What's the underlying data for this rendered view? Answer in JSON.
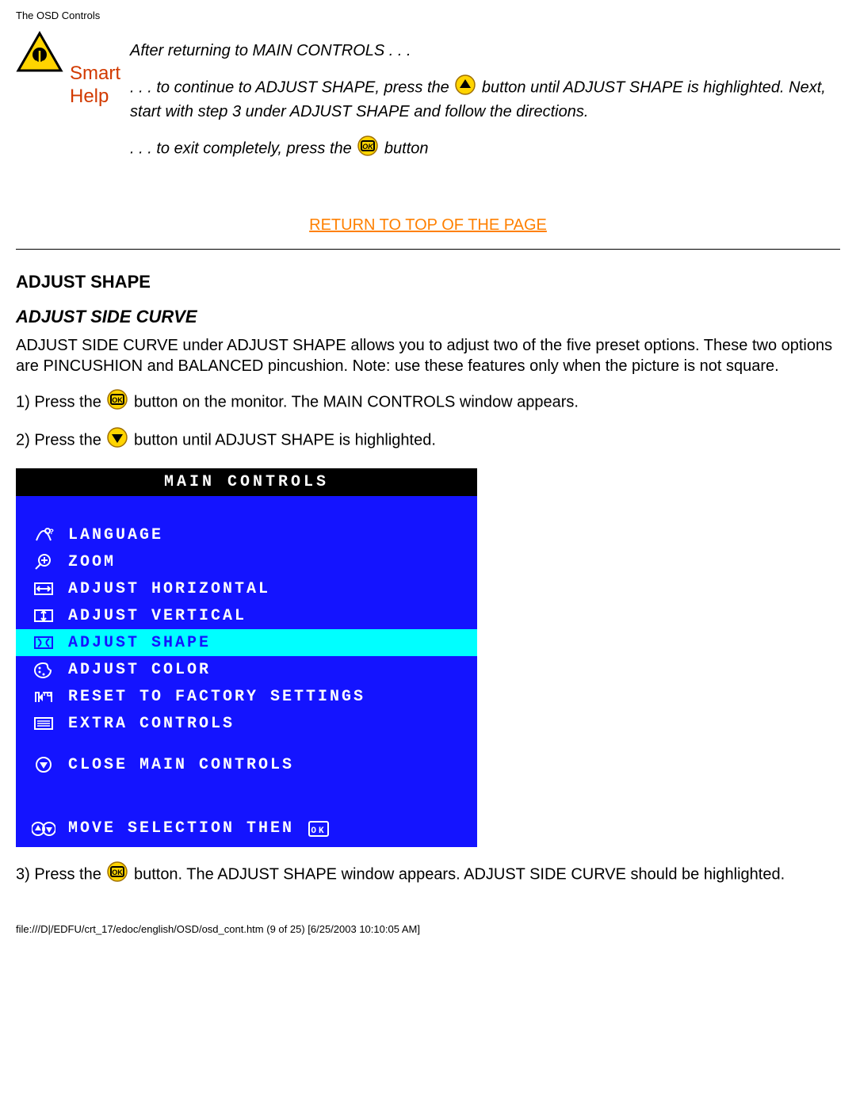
{
  "header": {
    "title": "The OSD Controls"
  },
  "smarthelp": {
    "smart": "Smart",
    "help": "Help"
  },
  "top": {
    "line1": "After returning to MAIN CONTROLS . . .",
    "line2a": ". . . to continue to ADJUST SHAPE, press the ",
    "line2b": " button until ADJUST SHAPE is highlighted. Next, start with step 3 under ADJUST SHAPE and follow the directions.",
    "line3a": ". . . to exit completely, press the ",
    "line3b": " button"
  },
  "return_link": "RETURN TO TOP OF THE PAGE",
  "section": {
    "title": "ADJUST SHAPE",
    "subtitle": "ADJUST SIDE CURVE"
  },
  "intro": "ADJUST SIDE CURVE under ADJUST SHAPE allows you to adjust two of the five preset options. These two options are PINCUSHION and BALANCED pincushion. Note: use these features only when the picture is not square.",
  "steps": {
    "s1a": "1) Press the ",
    "s1b": " button on the monitor. The MAIN CONTROLS window appears.",
    "s2a": "2) Press the ",
    "s2b": " button until ADJUST SHAPE is highlighted.",
    "s3a": "3) Press the ",
    "s3b": " button. The ADJUST SHAPE window appears. ADJUST SIDE CURVE should be highlighted."
  },
  "osd": {
    "title": "MAIN CONTROLS",
    "items": [
      {
        "label": "LANGUAGE",
        "icon": "globe",
        "selected": false
      },
      {
        "label": "ZOOM",
        "icon": "zoom",
        "selected": false
      },
      {
        "label": "ADJUST HORIZONTAL",
        "icon": "horiz",
        "selected": false
      },
      {
        "label": "ADJUST VERTICAL",
        "icon": "vert",
        "selected": false
      },
      {
        "label": "ADJUST SHAPE",
        "icon": "shape",
        "selected": true
      },
      {
        "label": "ADJUST COLOR",
        "icon": "palette",
        "selected": false
      },
      {
        "label": "RESET TO FACTORY SETTINGS",
        "icon": "reset",
        "selected": false
      },
      {
        "label": "EXTRA CONTROLS",
        "icon": "extra",
        "selected": false
      }
    ],
    "close": "CLOSE MAIN CONTROLS",
    "footer": "MOVE SELECTION THEN"
  },
  "footer_path": "file:///D|/EDFU/crt_17/edoc/english/OSD/osd_cont.htm (9 of 25) [6/25/2003 10:10:05 AM]"
}
